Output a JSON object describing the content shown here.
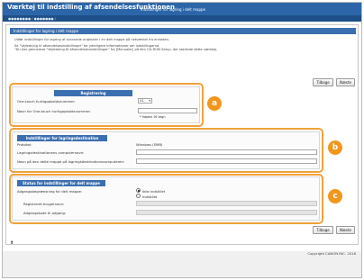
{
  "header": {
    "app_title": "Værktøj til indstilling af afsendelsesfunktionen",
    "page_subtitle": "Indstillinger for lagring i delt mappe"
  },
  "nav": {
    "breadcrumb": "●●●●●●●● / ●●●●●●● /"
  },
  "page": {
    "title": "Indstillinger for lagring i delt mappe",
    "desc_lines": [
      "Udfør indstillinger for lagring af scannede originaler i en delt mappe på netværket fra enheden.",
      "Se \"Vejledning til afsendelsesindstillinger\" for yderligere informationer om indstillingerne.",
      "\"Du kan gennemse \"Vejledning til afsendelsesindstillinger\" fra [Manualer] på den CD-ROM Setup, der startede dette værktøj."
    ]
  },
  "buttons": {
    "back": "Tilbage",
    "next": "Næste"
  },
  "registration": {
    "heading": "Registrering",
    "onetouch_number_label": "One-touch hurtigopkaldsnummer:",
    "onetouch_number_value": "01",
    "onetouch_name_label": "Navn for One-touch hurtigopkaldsnummer:",
    "onetouch_name_value": "",
    "max_chars_note": "* Højest 16 tegn"
  },
  "destination": {
    "heading": "Indstillinger for lagringsdestination",
    "protocol_label": "Protokol:",
    "protocol_value": "Windows (SMB)",
    "computer_name_label": "Lagringsdestinationens computernavn:",
    "folder_name_label": "Navn på den delte mappe på lagringsdestinationscomputeren:"
  },
  "status": {
    "heading": "Status for indstillinger for delt mappe",
    "access_label": "Adgangsbegrænsning for delt mappe:",
    "option_off": "Ikke indstillet",
    "option_on": "Indstillet",
    "username_label": "Registreret brugernavn:",
    "password_label": "Adgangskode til adgang:"
  },
  "callouts": {
    "a": "a",
    "b": "b",
    "c": "c"
  },
  "page_top_glyph": "⬆",
  "footer": {
    "copyright": "Copyright CANON INC. 2016"
  },
  "colors": {
    "header": "#2c66a8",
    "section_head": "#3c6faf",
    "callout": "#f2961c"
  },
  "icons": {
    "select_arrow": "chevron-down-icon",
    "page_top": "page-top-icon"
  }
}
